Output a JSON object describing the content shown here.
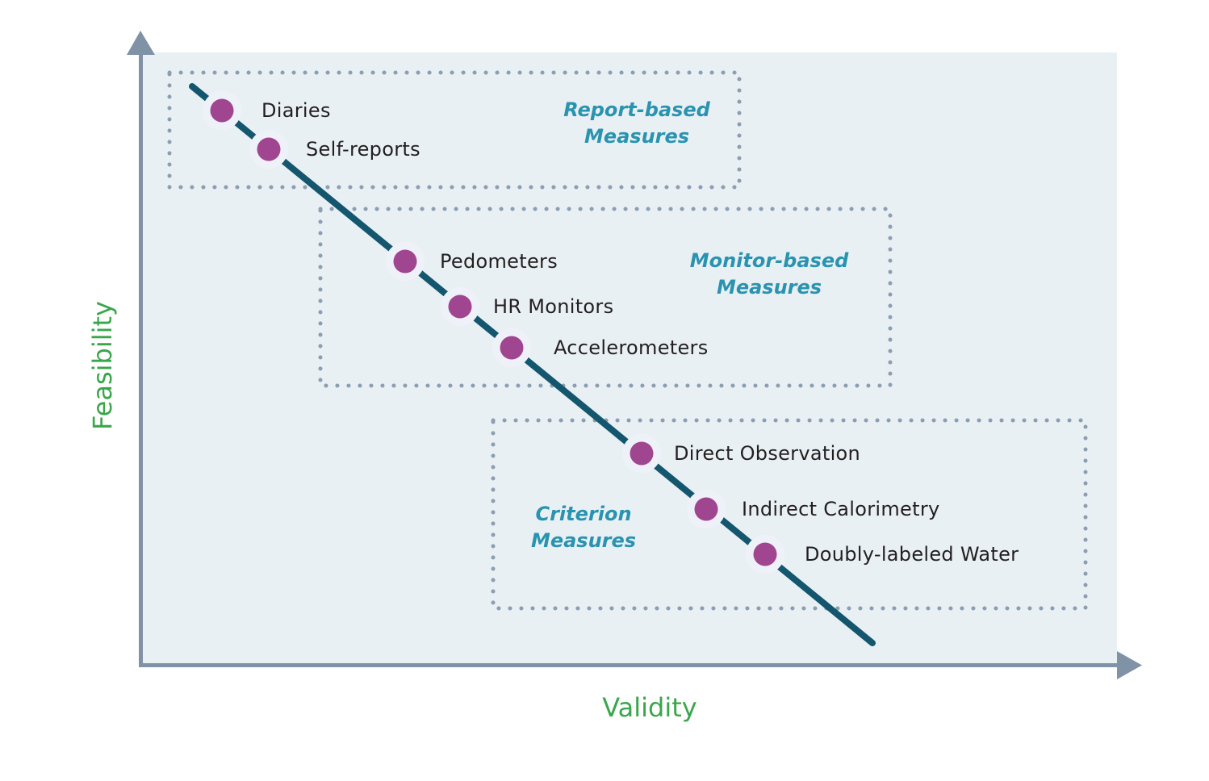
{
  "diagram": {
    "title": "",
    "x_axis_label": "Validity",
    "y_axis_label": "Feasibility",
    "colors": {
      "panel": "#e9f0f4",
      "axis": "#7f92a6",
      "trend_line": "#14566e",
      "point": "#a0458f",
      "point_halo": "#eef2f8",
      "group_border": "#8c9eb1",
      "group_label": "#2a93b0",
      "axis_label": "#3aa64b",
      "point_label": "#231f20"
    },
    "groups": [
      {
        "id": "report",
        "label_lines": [
          "Report-based",
          "Measures"
        ]
      },
      {
        "id": "monitor",
        "label_lines": [
          "Monitor-based",
          "Measures"
        ]
      },
      {
        "id": "criterion",
        "label_lines": [
          "Criterion",
          "Measures"
        ]
      }
    ],
    "points": [
      {
        "label": "Diaries",
        "group": "report"
      },
      {
        "label": "Self-reports",
        "group": "report"
      },
      {
        "label": "Pedometers",
        "group": "monitor"
      },
      {
        "label": "HR Monitors",
        "group": "monitor"
      },
      {
        "label": "Accelerometers",
        "group": "monitor"
      },
      {
        "label": "Direct Observation",
        "group": "criterion"
      },
      {
        "label": "Indirect Calorimetry",
        "group": "criterion"
      },
      {
        "label": "Doubly-labeled Water",
        "group": "criterion"
      }
    ],
    "relationship": "inverse: higher validity, lower feasibility"
  }
}
